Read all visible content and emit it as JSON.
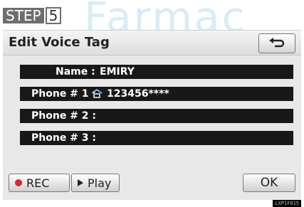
{
  "step": {
    "word": "STEP",
    "number": "5"
  },
  "watermark": "Farmac",
  "screen": {
    "title": "Edit Voice Tag",
    "rows": [
      {
        "label": "Name :",
        "value": "EMIRY"
      },
      {
        "label": "Phone # 1 :",
        "value": "123456****",
        "icon": "home-phone-icon"
      },
      {
        "label": "Phone # 2 :",
        "value": ""
      },
      {
        "label": "Phone # 3 :",
        "value": ""
      }
    ],
    "buttons": {
      "rec": "REC",
      "play": "Play",
      "ok": "OK",
      "back_icon": "return-arrow-icon"
    }
  },
  "image_code": "LXP1F015",
  "colors": {
    "row_bg": "#181818",
    "rec_dot": "#e0233a",
    "step_bg": "#6e6e6e"
  }
}
